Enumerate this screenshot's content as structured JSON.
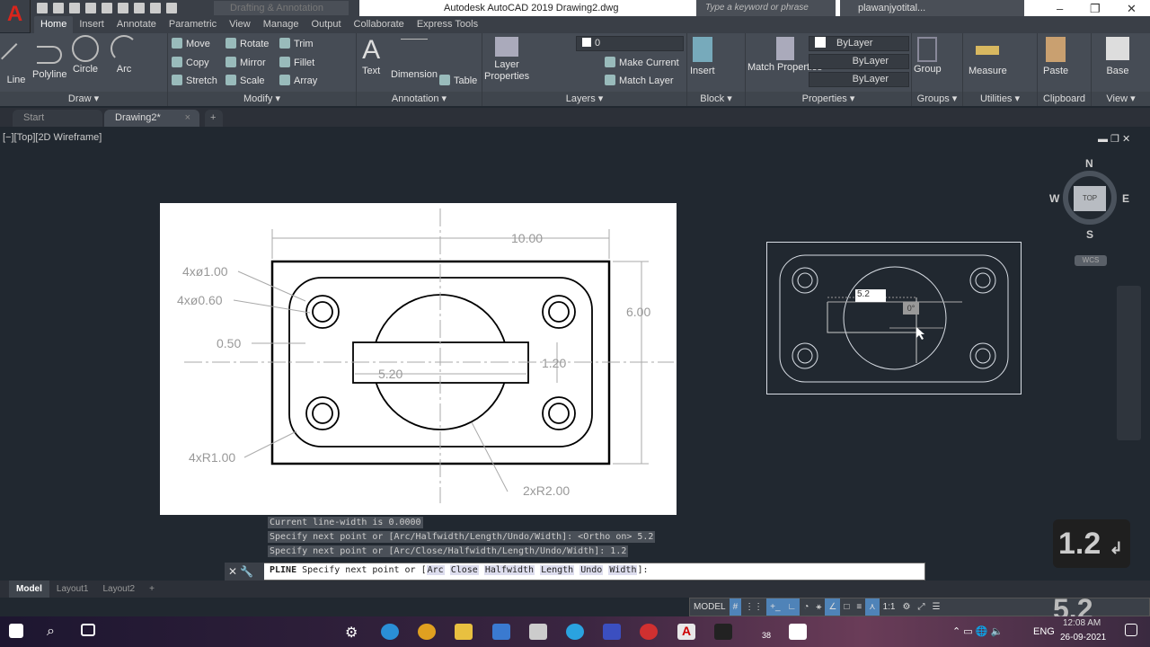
{
  "app": {
    "title": "Autodesk AutoCAD 2019    Drawing2.dwg",
    "app_letter": "A",
    "workspace": "Drafting & Annotation",
    "search_placeholder": "Type a keyword or phrase",
    "user": "plawanjyotital...",
    "minimize": "–",
    "maximize": "❐",
    "close": "✕"
  },
  "ribbon_tabs": [
    "Home",
    "Insert",
    "Annotate",
    "Parametric",
    "View",
    "Manage",
    "Output",
    "Collaborate",
    "Express Tools"
  ],
  "panels": {
    "draw": {
      "title": "Draw ▾",
      "line": "Line",
      "polyline": "Polyline",
      "circle": "Circle",
      "arc": "Arc"
    },
    "modify": {
      "title": "Modify ▾",
      "move": "Move",
      "rotate": "Rotate",
      "trim": "Trim",
      "copy": "Copy",
      "mirror": "Mirror",
      "fillet": "Fillet",
      "stretch": "Stretch",
      "scale": "Scale",
      "array": "Array"
    },
    "annotation": {
      "title": "Annotation ▾",
      "text": "Text",
      "dimension": "Dimension",
      "table": "Table"
    },
    "layers": {
      "title": "Layers ▾",
      "layer_properties": "Layer Properties",
      "layer_value": "0",
      "make_current": "Make Current",
      "match_layer": "Match Layer"
    },
    "block": {
      "title": "Block ▾",
      "insert": "Insert"
    },
    "properties": {
      "title": "Properties ▾",
      "match_properties": "Match Properties",
      "color": "ByLayer",
      "linetype": "ByLayer",
      "lineweight": "ByLayer"
    },
    "groups": {
      "title": "Groups ▾",
      "group": "Group"
    },
    "utilities": {
      "title": "Utilities ▾",
      "measure": "Measure"
    },
    "clipboard": {
      "title": "Clipboard",
      "paste": "Paste"
    },
    "view": {
      "title": "View ▾",
      "base": "Base"
    }
  },
  "file_tabs": [
    "Start",
    "Drawing2*"
  ],
  "viewport_label": "[−][Top][2D Wireframe]",
  "reference_drawing": {
    "dim_width": "10.00",
    "dim_height": "6.00",
    "hole_large": "4xø1.00",
    "hole_small": "4xø0.60",
    "offset": "0.50",
    "slot_len": "5.20",
    "slot_h": "1.20",
    "corner_r": "4xR1.00",
    "circle_r": "2xR2.00"
  },
  "dynamic_input": {
    "length": "5.2",
    "angle": "0°"
  },
  "viewcube": {
    "n": "N",
    "s": "S",
    "e": "E",
    "w": "W",
    "top": "TOP",
    "wcs": "WCS"
  },
  "command_history": [
    "Current line-width is 0.0000",
    "Specify next point or [Arc/Halfwidth/Length/Undo/Width]:  <Ortho on> 5.2",
    "Specify next point or [Arc/Close/Halfwidth/Length/Undo/Width]: 1.2"
  ],
  "command_line": {
    "cmd": "PLINE",
    "prompt": "Specify next point or [",
    "options": [
      "Arc",
      "Close",
      "Halfwidth",
      "Length",
      "Undo",
      "Width"
    ],
    "end": "]:"
  },
  "layout_tabs": [
    "Model",
    "Layout1",
    "Layout2",
    "+"
  ],
  "status": {
    "model": "MODEL",
    "scale": "1:1"
  },
  "keys_overlay": [
    "1.2",
    "5.2"
  ],
  "taskbar": {
    "badge": "38",
    "lang": "ENG",
    "time": "12:08 AM",
    "date": "26-09-2021"
  }
}
